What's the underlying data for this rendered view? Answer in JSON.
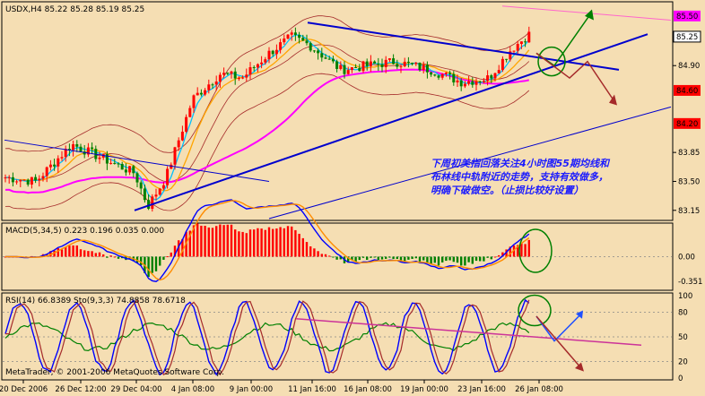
{
  "chart_data": [
    {
      "type": "candlestick",
      "header": "USDX,H4  85.22 85.28 85.19 85.25",
      "price_labels": [
        "85.50",
        "85.25",
        "84.90",
        "84.60",
        "84.20",
        "83.85",
        "83.50",
        "83.15"
      ],
      "price_levels": [
        85.5,
        85.25,
        84.9,
        84.6,
        84.2,
        83.85,
        83.5,
        83.15
      ],
      "highlight_levels": [
        {
          "value": "85.50",
          "color": "#ff00ff"
        },
        {
          "value": "84.60",
          "color": "#ff0000"
        },
        {
          "value": "84.20",
          "color": "#ff0000"
        }
      ],
      "current_price": "85.25",
      "ylim": [
        83.05,
        85.65
      ],
      "annotation": [
        "下周初美指回落关注4小时图55期均线和",
        "布林线中轨附近的走势，支持有效做多，",
        "明确下破做空。（止损比较好设置）"
      ]
    },
    {
      "type": "macd",
      "header": "MACD(5,34,5) 0.223 0.196 0.035 0.000",
      "levels": [
        "0.00",
        "-0.351"
      ],
      "ylim": [
        -0.45,
        0.45
      ]
    },
    {
      "type": "rsi_stochastic",
      "header": "RSI(14) 66.8389 Sto(9,3,3) 74.8858 78.6718",
      "levels": [
        "100",
        "80",
        "50",
        "20",
        "0"
      ],
      "ylim": [
        0,
        100
      ]
    }
  ],
  "x_labels": [
    "20 Dec 2006",
    "26 Dec 12:00",
    "29 Dec 04:00",
    "4 Jan 08:00",
    "9 Jan 00:00",
    "11 Jan 16:00",
    "16 Jan 08:00",
    "19 Jan 00:00",
    "23 Jan 16:00",
    "26 Jan 08:00"
  ],
  "watermark": "MetaTrader, © 2001-2006 MetaQuotes Software Corp.",
  "colors": {
    "background": "#f5deb3",
    "bull": "#ff0000",
    "bear": "#008000",
    "trend": "#0000cd",
    "ma55": "#ff00ff",
    "bollinger": "#a52a2a",
    "ma_fast": "#00bfff",
    "ma_mid": "#ffa500"
  }
}
